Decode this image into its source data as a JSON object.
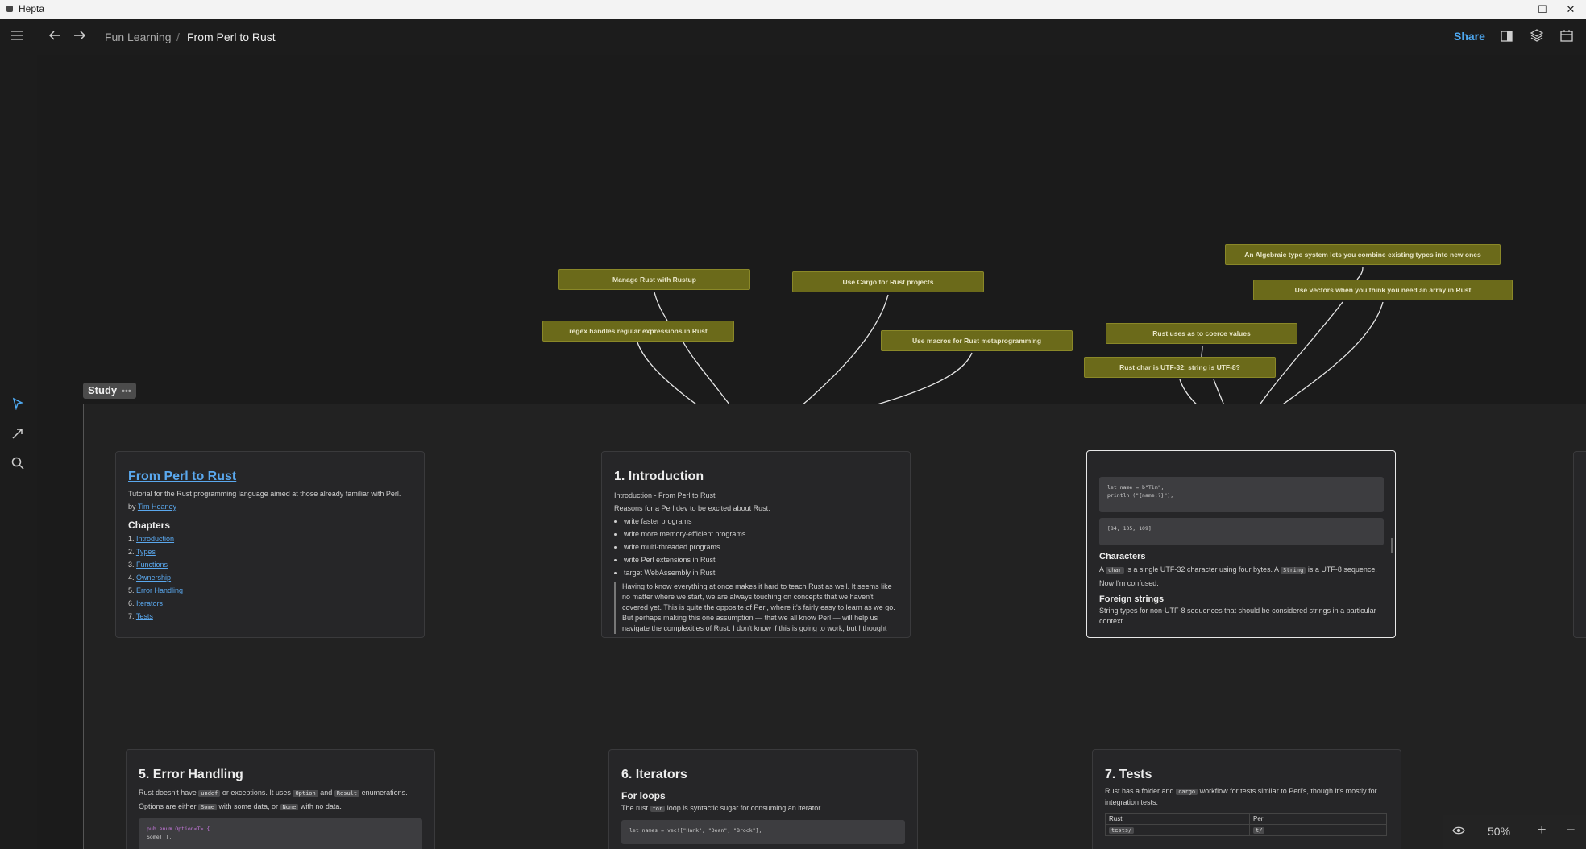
{
  "window": {
    "title": "Hepta",
    "minimize": "—",
    "maximize": "☐",
    "close": "✕"
  },
  "toolbar": {
    "menu_icon": "menu-icon",
    "back_icon": "arrow-left-icon",
    "forward_icon": "arrow-right-icon",
    "breadcrumb": [
      "Fun Learning",
      "From Perl to Rust"
    ],
    "breadcrumb_sep": "/",
    "share_label": "Share"
  },
  "sidebar": {
    "tools": [
      "pointer-icon",
      "arrow-tool-icon",
      "search-icon"
    ]
  },
  "canvas": {
    "frame_label": "Study",
    "frame_menu": "•••",
    "notes": [
      "Manage Rust with Rustup",
      "regex handles regular expressions in Rust",
      "Use Cargo for Rust projects",
      "Use macros for Rust metaprogramming",
      "An Algebraic type system lets you combine existing types into new ones",
      "Use vectors when you think you need an array in Rust",
      "Rust uses as to coerce values",
      "Rust char is UTF-32; string is UTF-8?"
    ],
    "card_main": {
      "title": "From Perl to Rust",
      "desc": "Tutorial for the Rust programming language aimed at those already familiar with Perl.",
      "by": "by",
      "author": "Tim Heaney",
      "chapters_heading": "Chapters",
      "chapters": [
        {
          "num": "1.",
          "label": "Introduction"
        },
        {
          "num": "2.",
          "label": "Types"
        },
        {
          "num": "3.",
          "label": "Functions"
        },
        {
          "num": "4.",
          "label": "Ownership"
        },
        {
          "num": "5.",
          "label": "Error Handling"
        },
        {
          "num": "6.",
          "label": "Iterators"
        },
        {
          "num": "7.",
          "label": "Tests"
        }
      ]
    },
    "card_intro": {
      "title": "1. Introduction",
      "link": "Introduction - From Perl to Rust",
      "lead": "Reasons for a Perl dev to be excited about Rust:",
      "bullets": [
        "write faster programs",
        "write more memory-efficient programs",
        "write multi-threaded programs",
        "write Perl extensions in Rust",
        "target WebAssembly in Rust"
      ],
      "quote": "Having to know everything at once makes it hard to teach Rust as well. It seems like no matter where we start, we are always touching on concepts that we haven't covered yet. This is quite the opposite of Perl, where it's fairly easy to learn as we go. But perhaps making this one assumption — that we all know Perl — will help us navigate the complexities of Rust. I don't know if this is going to work, but I thought"
    },
    "card_chars": {
      "code1_line1": "let name = b\"Tim\";",
      "code1_line2": "println!(\"{name:?}\");",
      "code2": "[84, 105, 109]",
      "h_chars": "Characters",
      "chars_a": "A",
      "chars_char": "char",
      "chars_b": "is a single UTF-32 character using four bytes. A",
      "chars_string": "String",
      "chars_c": "is a UTF-8 sequence.",
      "chars_d": "Now I'm confused.",
      "h_foreign": "Foreign strings",
      "foreign": "String types for non-UTF-8 sequences that should be considered strings in a particular context."
    },
    "card_err": {
      "title": "5. Error Handling",
      "l1a": "Rust doesn't have",
      "l1b": "undef",
      "l1c": "or exceptions. It uses",
      "l1d": "Option",
      "l1e": "and",
      "l1f": "Result",
      "l1g": "enumerations.",
      "l2a": "Options are either",
      "l2b": "Some",
      "l2c": "with some data, or",
      "l2d": "None",
      "l2e": "with no data.",
      "code_l1": "pub enum Option<T> {",
      "code_l2": "  Some(T),"
    },
    "card_iter": {
      "title": "6. Iterators",
      "sub": "For loops",
      "l1a": "The rust",
      "l1b": "for",
      "l1c": "loop is syntactic sugar for consuming an iterator.",
      "code_l1": "let names = vec![\"Hank\", \"Dean\", \"Brock\"];"
    },
    "card_tests": {
      "title": "7. Tests",
      "l1a": "Rust has a folder and",
      "l1b": "cargo",
      "l1c": "workflow for tests similar to Perl's, though it's mostly for",
      "l2": "integration tests.",
      "table_head": [
        "Rust",
        "Perl"
      ],
      "table_row": [
        "tests/",
        "t/"
      ]
    }
  },
  "zoom": {
    "value": "50%",
    "eye_icon": "eye-icon",
    "plus": "+",
    "minus": "−"
  }
}
